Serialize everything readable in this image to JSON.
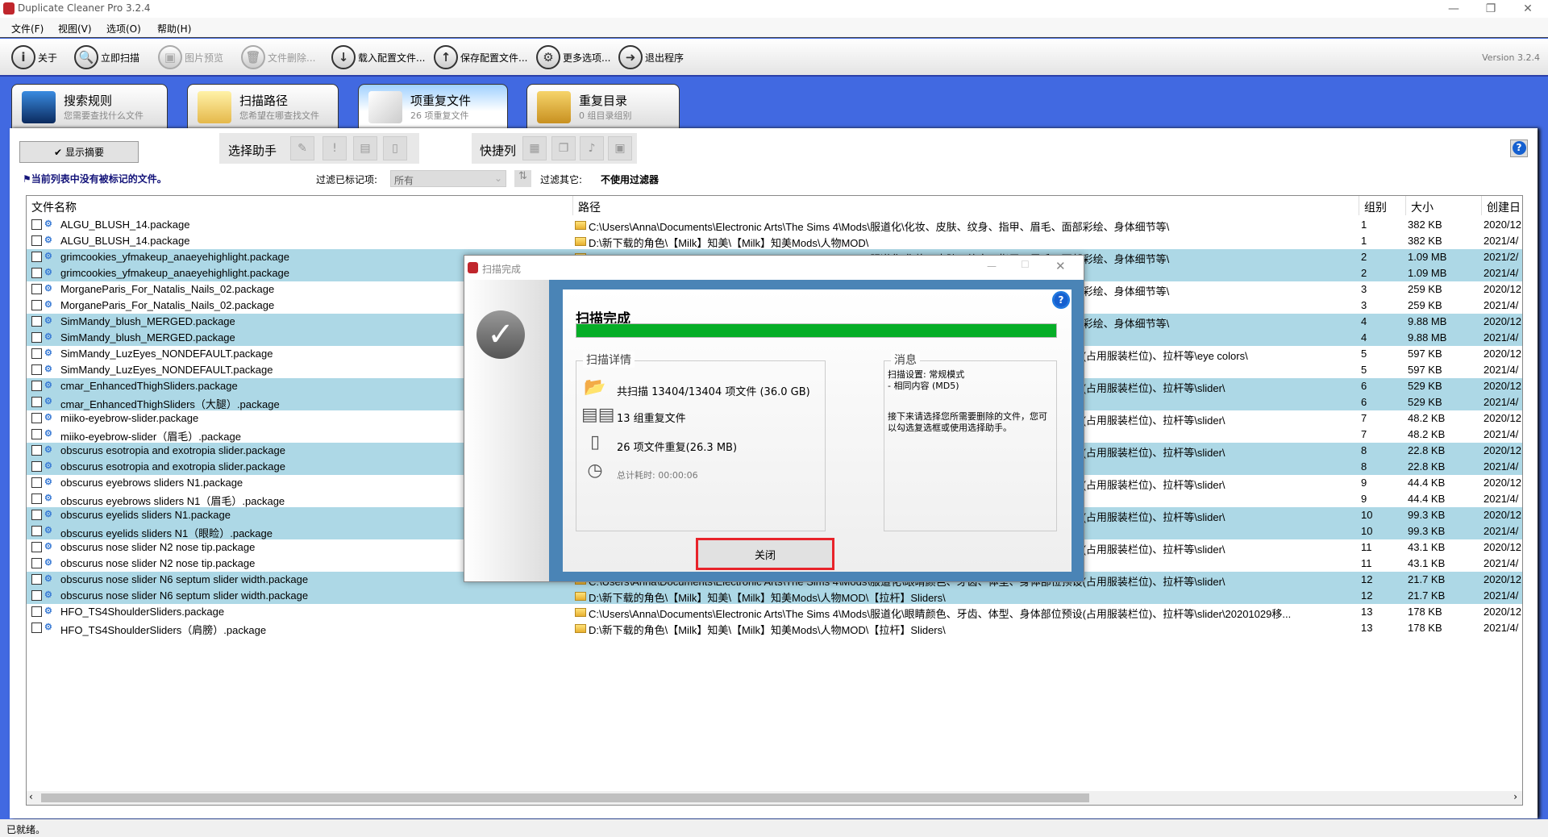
{
  "window": {
    "title": "Duplicate Cleaner Pro 3.2.4",
    "min": "—",
    "max": "❐",
    "close": "✕"
  },
  "menu": [
    "文件(F)",
    "视图(V)",
    "选项(O)",
    "帮助(H)"
  ],
  "toolbar": {
    "items": [
      {
        "label": "关于",
        "icon": "i",
        "enabled": true
      },
      {
        "label": "立即扫描",
        "icon": "🔍",
        "enabled": true
      },
      {
        "label": "图片预览",
        "icon": "▣",
        "enabled": false
      },
      {
        "label": "文件删除...",
        "icon": "🗑",
        "enabled": false
      },
      {
        "label": "载入配置文件...",
        "icon": "↓",
        "enabled": true
      },
      {
        "label": "保存配置文件...",
        "icon": "↑",
        "enabled": true
      },
      {
        "label": "更多选项...",
        "icon": "⚙",
        "enabled": true
      },
      {
        "label": "退出程序",
        "icon": "➜",
        "enabled": true
      }
    ],
    "version": "Version 3.2.4"
  },
  "tabs": [
    {
      "title": "搜索规则",
      "subtitle": "您需要查找什么文件",
      "active": false
    },
    {
      "title": "扫描路径",
      "subtitle": "您希望在哪查找文件",
      "active": false
    },
    {
      "title": "项重复文件",
      "subtitle": "26 项重复文件",
      "active": true
    },
    {
      "title": "重复目录",
      "subtitle": "0 组目录组别",
      "active": false
    }
  ],
  "controls": {
    "show_summary": "显示摘要",
    "selection_assistant": "选择助手",
    "quick_columns": "快捷列",
    "no_marked": "当前列表中没有被标记的文件。",
    "filter_marked_label": "过滤已标记项:",
    "filter_marked_value": "所有",
    "filter_other_label": "过滤其它:",
    "filter_other_value": "不使用过滤器"
  },
  "columns": [
    "文件名称",
    "路径",
    "组别",
    "大小",
    "创建日"
  ],
  "rows": [
    {
      "name": "ALGU_BLUSH_14.package",
      "path": "C:\\Users\\Anna\\Documents\\Electronic Arts\\The Sims 4\\Mods\\服道化\\化妆、皮肤、纹身、指甲、眉毛、面部彩绘、身体细节等\\",
      "group": "1",
      "size": "382 KB",
      "created": "2020/12"
    },
    {
      "name": "ALGU_BLUSH_14.package",
      "path": "D:\\新下载的角色\\【Milk】知美\\【Milk】知美Mods\\人物MOD\\",
      "group": "1",
      "size": "382 KB",
      "created": "2021/4/"
    },
    {
      "name": "grimcookies_yfmakeup_anaeyehighlight.package",
      "path": "C:\\Users\\Anna\\Documents\\Electronic Arts\\The Sims 4\\Mods\\服道化\\化妆、皮肤、纹身、指甲、眉毛、面部彩绘、身体细节等\\",
      "group": "2",
      "size": "1.09 MB",
      "created": "2021/2/"
    },
    {
      "name": "grimcookies_yfmakeup_anaeyehighlight.package",
      "path": "",
      "group": "2",
      "size": "1.09 MB",
      "created": "2021/4/"
    },
    {
      "name": "MorganeParis_For_Natalis_Nails_02.package",
      "path": "C:\\Users\\Anna\\Documents\\Electronic Arts\\The Sims 4\\Mods\\服道化\\化妆、皮肤、纹身、指甲、眉毛、面部彩绘、身体细节等\\",
      "group": "3",
      "size": "259 KB",
      "created": "2020/12"
    },
    {
      "name": "MorganeParis_For_Natalis_Nails_02.package",
      "path": "",
      "group": "3",
      "size": "259 KB",
      "created": "2021/4/"
    },
    {
      "name": "SimMandy_blush_MERGED.package",
      "path": "C:\\Users\\Anna\\Documents\\Electronic Arts\\The Sims 4\\Mods\\服道化\\化妆、皮肤、纹身、指甲、眉毛、面部彩绘、身体细节等\\",
      "group": "4",
      "size": "9.88 MB",
      "created": "2020/12"
    },
    {
      "name": "SimMandy_blush_MERGED.package",
      "path": "",
      "group": "4",
      "size": "9.88 MB",
      "created": "2021/4/"
    },
    {
      "name": "SimMandy_LuzEyes_NONDEFAULT.package",
      "path": "C:\\Users\\Anna\\Documents\\Electronic Arts\\The Sims 4\\Mods\\服道化\\眼睛颜色、牙齿、体型、身体部位预设(占用服装栏位)、拉杆等\\eye colors\\",
      "group": "5",
      "size": "597 KB",
      "created": "2020/12"
    },
    {
      "name": "SimMandy_LuzEyes_NONDEFAULT.package",
      "path": "",
      "group": "5",
      "size": "597 KB",
      "created": "2021/4/"
    },
    {
      "name": "cmar_EnhancedThighSliders.package",
      "path": "C:\\Users\\Anna\\Documents\\Electronic Arts\\The Sims 4\\Mods\\服道化\\眼睛颜色、牙齿、体型、身体部位预设(占用服装栏位)、拉杆等\\slider\\",
      "group": "6",
      "size": "529 KB",
      "created": "2020/12"
    },
    {
      "name": "cmar_EnhancedThighSliders（大腿）.package",
      "path": "",
      "group": "6",
      "size": "529 KB",
      "created": "2021/4/"
    },
    {
      "name": "miiko-eyebrow-slider.package",
      "path": "C:\\Users\\Anna\\Documents\\Electronic Arts\\The Sims 4\\Mods\\服道化\\眼睛颜色、牙齿、体型、身体部位预设(占用服装栏位)、拉杆等\\slider\\",
      "group": "7",
      "size": "48.2 KB",
      "created": "2020/12"
    },
    {
      "name": "miiko-eyebrow-slider（眉毛）.package",
      "path": "",
      "group": "7",
      "size": "48.2 KB",
      "created": "2021/4/"
    },
    {
      "name": "obscurus esotropia and exotropia slider.package",
      "path": "C:\\Users\\Anna\\Documents\\Electronic Arts\\The Sims 4\\Mods\\服道化\\眼睛颜色、牙齿、体型、身体部位预设(占用服装栏位)、拉杆等\\slider\\",
      "group": "8",
      "size": "22.8 KB",
      "created": "2020/12"
    },
    {
      "name": "obscurus esotropia and exotropia slider.package",
      "path": "",
      "group": "8",
      "size": "22.8 KB",
      "created": "2021/4/"
    },
    {
      "name": "obscurus eyebrows sliders N1.package",
      "path": "C:\\Users\\Anna\\Documents\\Electronic Arts\\The Sims 4\\Mods\\服道化\\眼睛颜色、牙齿、体型、身体部位预设(占用服装栏位)、拉杆等\\slider\\",
      "group": "9",
      "size": "44.4 KB",
      "created": "2020/12"
    },
    {
      "name": "obscurus eyebrows sliders N1（眉毛）.package",
      "path": "",
      "group": "9",
      "size": "44.4 KB",
      "created": "2021/4/"
    },
    {
      "name": "obscurus eyelids sliders N1.package",
      "path": "C:\\Users\\Anna\\Documents\\Electronic Arts\\The Sims 4\\Mods\\服道化\\眼睛颜色、牙齿、体型、身体部位预设(占用服装栏位)、拉杆等\\slider\\",
      "group": "10",
      "size": "99.3 KB",
      "created": "2020/12"
    },
    {
      "name": "obscurus eyelids sliders N1（眼睑）.package",
      "path": "",
      "group": "10",
      "size": "99.3 KB",
      "created": "2021/4/"
    },
    {
      "name": "obscurus nose slider N2 nose tip.package",
      "path": "C:\\Users\\Anna\\Documents\\Electronic Arts\\The Sims 4\\Mods\\服道化\\眼睛颜色、牙齿、体型、身体部位预设(占用服装栏位)、拉杆等\\slider\\",
      "group": "11",
      "size": "43.1 KB",
      "created": "2020/12"
    },
    {
      "name": "obscurus nose slider N2 nose tip.package",
      "path": "",
      "group": "11",
      "size": "43.1 KB",
      "created": "2021/4/"
    },
    {
      "name": "obscurus nose slider N6 septum slider width.package",
      "path": "C:\\Users\\Anna\\Documents\\Electronic Arts\\The Sims 4\\Mods\\服道化\\眼睛颜色、牙齿、体型、身体部位预设(占用服装栏位)、拉杆等\\slider\\",
      "group": "12",
      "size": "21.7 KB",
      "created": "2020/12"
    },
    {
      "name": "obscurus nose slider N6 septum slider width.package",
      "path": "D:\\新下载的角色\\【Milk】知美\\【Milk】知美Mods\\人物MOD\\【拉杆】Sliders\\",
      "group": "12",
      "size": "21.7 KB",
      "created": "2021/4/"
    },
    {
      "name": "HFO_TS4ShoulderSliders.package",
      "path": "C:\\Users\\Anna\\Documents\\Electronic Arts\\The Sims 4\\Mods\\服道化\\眼睛颜色、牙齿、体型、身体部位预设(占用服装栏位)、拉杆等\\slider\\20201029移...",
      "group": "13",
      "size": "178 KB",
      "created": "2020/12"
    },
    {
      "name": "HFO_TS4ShoulderSliders（肩膀）.package",
      "path": "D:\\新下载的角色\\【Milk】知美\\【Milk】知美Mods\\人物MOD\\【拉杆】Sliders\\",
      "group": "13",
      "size": "178 KB",
      "created": "2021/4/"
    }
  ],
  "status": "已就绪。",
  "dialog": {
    "title": "扫描完成",
    "heading": "扫描完成",
    "progress": 100,
    "details_title": "扫描详情",
    "scanned": "共扫描 13404/13404 项文件 (36.0 GB)",
    "groups": "13 组重复文件",
    "dupes": "26 项文件重复(26.3 MB)",
    "elapsed": "总计耗时: 00:00:06",
    "msg_title": "消息",
    "msg_settings": "扫描设置: 常规模式",
    "msg_mode": "- 相同内容 (MD5)",
    "msg_next": "接下来请选择您所需要删除的文件，您可以勾选复选框或使用选择助手。",
    "close": "关闭"
  },
  "colors": {
    "background": "#4169e1",
    "selected_row": "#add8e6",
    "progress": "#06ae27",
    "close_highlight": "#e8232a"
  }
}
